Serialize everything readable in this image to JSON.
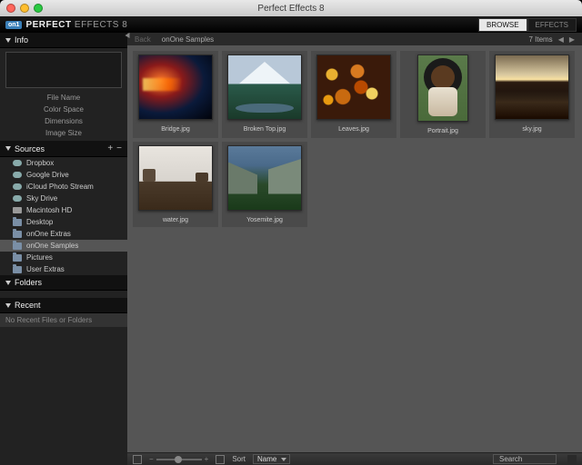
{
  "window": {
    "title": "Perfect Effects 8"
  },
  "brand": {
    "badge": "on1",
    "name_bold": "PERFECT",
    "name_light": " EFFECTS 8"
  },
  "modes": {
    "browse": "BROWSE",
    "effects": "EFFECTS"
  },
  "panels": {
    "info": {
      "title": "Info",
      "rows": [
        "File Name",
        "Color Space",
        "Dimensions",
        "Image Size"
      ]
    },
    "sources": {
      "title": "Sources",
      "items": [
        {
          "label": "Dropbox",
          "icon": "cloud"
        },
        {
          "label": "Google Drive",
          "icon": "cloud"
        },
        {
          "label": "iCloud Photo Stream",
          "icon": "cloud"
        },
        {
          "label": "Sky Drive",
          "icon": "cloud"
        },
        {
          "label": "Macintosh HD",
          "icon": "drive"
        },
        {
          "label": "Desktop",
          "icon": "folder"
        },
        {
          "label": "onOne Extras",
          "icon": "folder"
        },
        {
          "label": "onOne Samples",
          "icon": "folder",
          "selected": true
        },
        {
          "label": "Pictures",
          "icon": "folder"
        },
        {
          "label": "User Extras",
          "icon": "folder"
        }
      ]
    },
    "folders": {
      "title": "Folders"
    },
    "recent": {
      "title": "Recent",
      "empty": "No Recent Files or Folders"
    }
  },
  "browser": {
    "crumb_back": "Back",
    "crumb_current": "onOne Samples",
    "count_label": "7 Items",
    "items": [
      {
        "name": "Bridge.jpg",
        "art": "r1"
      },
      {
        "name": "Broken Top.jpg",
        "art": "r2"
      },
      {
        "name": "Leaves.jpg",
        "art": "r3"
      },
      {
        "name": "Portrait.jpg",
        "art": "r4",
        "portrait": true
      },
      {
        "name": "sky.jpg",
        "art": "r5"
      },
      {
        "name": "water.jpg",
        "art": "r6"
      },
      {
        "name": "Yosemite.jpg",
        "art": "r7"
      }
    ]
  },
  "bottom": {
    "sort_label": "Sort",
    "sort_value": "Name",
    "search_placeholder": "Search"
  }
}
